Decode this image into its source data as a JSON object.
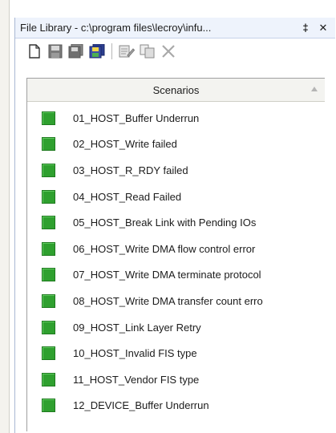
{
  "panel": {
    "title": "File Library - c:\\program files\\lecroy\\infu...",
    "pin_glyph": "‡",
    "close_glyph": "✕"
  },
  "toolbar": {
    "icons": [
      "new-file-icon",
      "save-icon",
      "save-all-icon",
      "multi-save-icon",
      "edit-icon",
      "copy-icon",
      "delete-icon"
    ]
  },
  "list": {
    "column_header": "Scenarios",
    "sort_glyph": "▲",
    "items": [
      {
        "label": "01_HOST_Buffer Underrun"
      },
      {
        "label": "02_HOST_Write failed"
      },
      {
        "label": "03_HOST_R_RDY failed"
      },
      {
        "label": "04_HOST_Read Failed"
      },
      {
        "label": "05_HOST_Break Link with Pending IOs"
      },
      {
        "label": "06_HOST_Write DMA flow control error"
      },
      {
        "label": "07_HOST_Write DMA terminate protocol"
      },
      {
        "label": "08_HOST_Write DMA transfer count erro"
      },
      {
        "label": "09_HOST_Link Layer Retry"
      },
      {
        "label": "10_HOST_Invalid FIS type"
      },
      {
        "label": "11_HOST_Vendor FIS type"
      },
      {
        "label": "12_DEVICE_Buffer Underrun"
      }
    ]
  },
  "colors": {
    "status_green": "#2fa02f",
    "title_bg": "#eef3fc"
  }
}
